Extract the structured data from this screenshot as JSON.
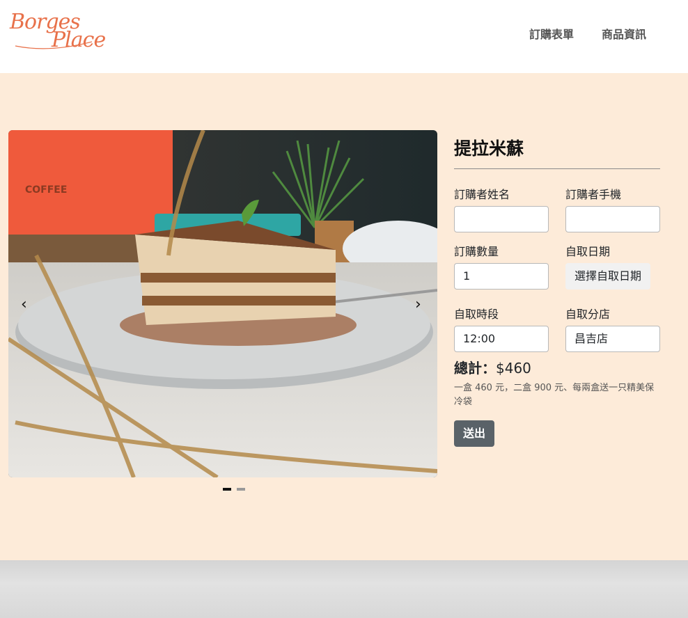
{
  "header": {
    "logo_line1": "Borges",
    "logo_line2": "Place",
    "nav": [
      "訂購表單",
      "商品資訊"
    ]
  },
  "carousel": {
    "image_text": "COFFEE",
    "prev_icon": "chevron-left-icon",
    "next_icon": "chevron-right-icon",
    "slide_count": 2,
    "active_slide": 1
  },
  "form": {
    "title": "提拉米蘇",
    "name_label": "訂購者姓名",
    "name_value": "",
    "phone_label": "訂購者手機",
    "phone_value": "",
    "qty_label": "訂購數量",
    "qty_value": "1",
    "date_label": "自取日期",
    "date_button": "選擇自取日期",
    "time_label": "自取時段",
    "time_value": "12:00",
    "branch_label": "自取分店",
    "branch_value": "昌吉店",
    "total_label": "總計：",
    "total_value": "$460",
    "note": "一盒 460 元，二盒 900 元、每兩盒送一只精美保冷袋",
    "submit_label": "送出"
  },
  "colors": {
    "page_bg": "#fdebd9",
    "brand": "#e8714a",
    "submit_bg": "#5a6268"
  }
}
